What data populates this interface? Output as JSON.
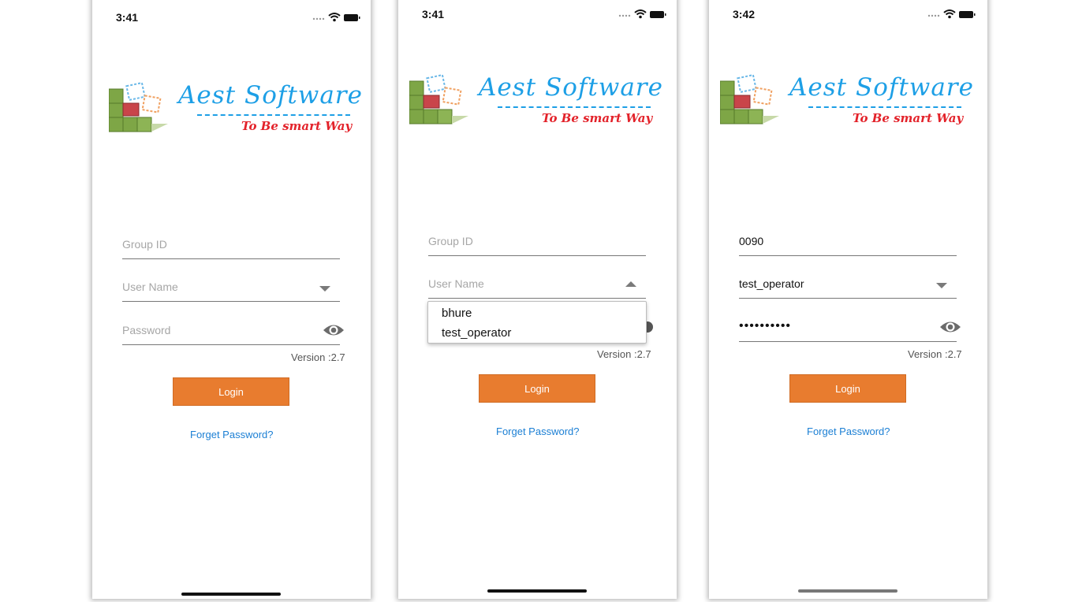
{
  "screens": [
    {
      "time": "3:41",
      "logo": {
        "title": "Aest Software",
        "tagline": "To Be smart Way"
      },
      "group_id": {
        "placeholder": "Group ID",
        "value": ""
      },
      "user_name": {
        "placeholder": "User Name",
        "value": "",
        "dropdown_open": false
      },
      "password": {
        "placeholder": "Password",
        "value": ""
      },
      "version": "Version :2.7",
      "login_label": "Login",
      "forgot_label": "Forget Password?"
    },
    {
      "time": "3:41",
      "logo": {
        "title": "Aest Software",
        "tagline": "To Be smart Way"
      },
      "group_id": {
        "placeholder": "Group ID",
        "value": ""
      },
      "user_name": {
        "placeholder": "User Name",
        "value": "",
        "dropdown_open": true,
        "options": [
          "bhure",
          "test_operator"
        ]
      },
      "version": "Version :2.7",
      "login_label": "Login",
      "forgot_label": "Forget Password?"
    },
    {
      "time": "3:42",
      "logo": {
        "title": "Aest Software",
        "tagline": "To Be smart Way"
      },
      "group_id": {
        "placeholder": "Group ID",
        "value": "0090"
      },
      "user_name": {
        "placeholder": "User Name",
        "value": "test_operator",
        "dropdown_open": false
      },
      "password": {
        "placeholder": "Password",
        "value": "••••••••••"
      },
      "version": "Version :2.7",
      "login_label": "Login",
      "forgot_label": "Forget Password?"
    }
  ],
  "colors": {
    "accent": "#e87c2f",
    "link": "#1b7fd4",
    "logo_blue": "#1d9fe6",
    "logo_red": "#e3222a"
  },
  "icons": [
    "wifi-icon",
    "battery-icon",
    "signal-icon",
    "eye-icon",
    "caret-down-icon",
    "caret-up-icon"
  ]
}
